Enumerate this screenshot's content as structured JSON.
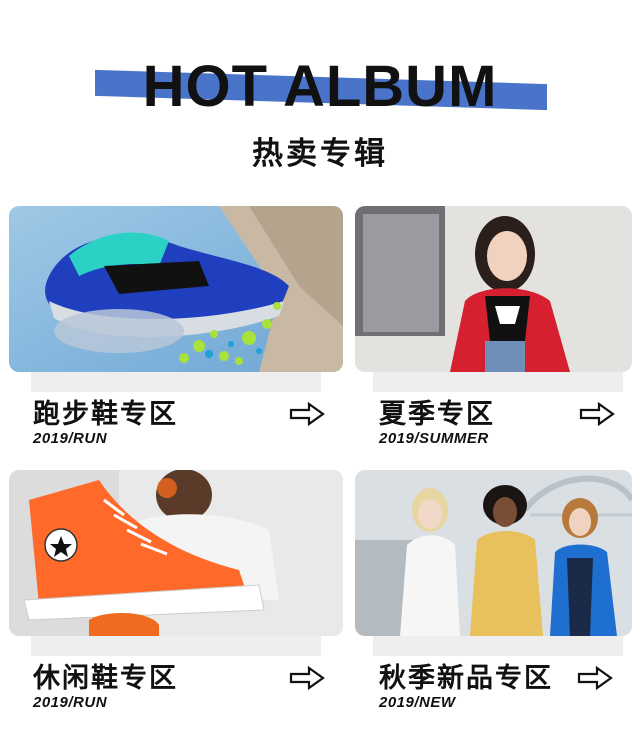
{
  "header": {
    "title_en": "HOT ALBUM",
    "title_cn": "热卖专辑",
    "accent_color": "#4a74c9"
  },
  "cards": [
    {
      "label": "跑步鞋专区",
      "sub": "2019/RUN",
      "image": "running-shoe-photo",
      "icon": "arrow-right-icon"
    },
    {
      "label": "夏季专区",
      "sub": "2019/SUMMER",
      "image": "model-red-jacket-photo",
      "icon": "arrow-right-icon"
    },
    {
      "label": "休闲鞋专区",
      "sub": "2019/RUN",
      "image": "orange-converse-photo",
      "icon": "arrow-right-icon"
    },
    {
      "label": "秋季新品专区",
      "sub": "2019/NEW",
      "image": "group-street-style-photo",
      "icon": "arrow-right-icon"
    }
  ]
}
